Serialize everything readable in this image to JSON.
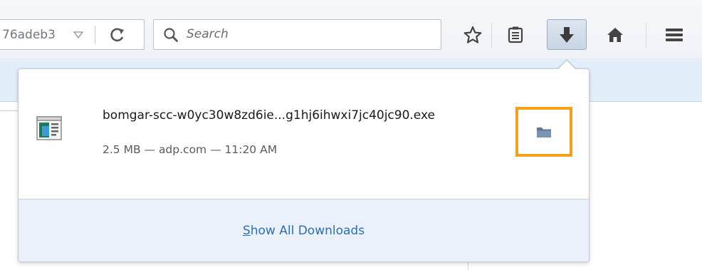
{
  "toolbar": {
    "url_text": "76adeb3",
    "search_placeholder": "Search"
  },
  "downloads_panel": {
    "item": {
      "filename": "bomgar-scc-w0yc30w8zd6ie...g1hj6ihwxi7jc40jc90.exe",
      "status": "2.5 MB — adp.com — 11:20 AM"
    },
    "show_all_label_key": "S",
    "show_all_label_rest": "how All Downloads"
  },
  "colors": {
    "highlight": "#f5a11e",
    "link": "#2c6eb8"
  }
}
